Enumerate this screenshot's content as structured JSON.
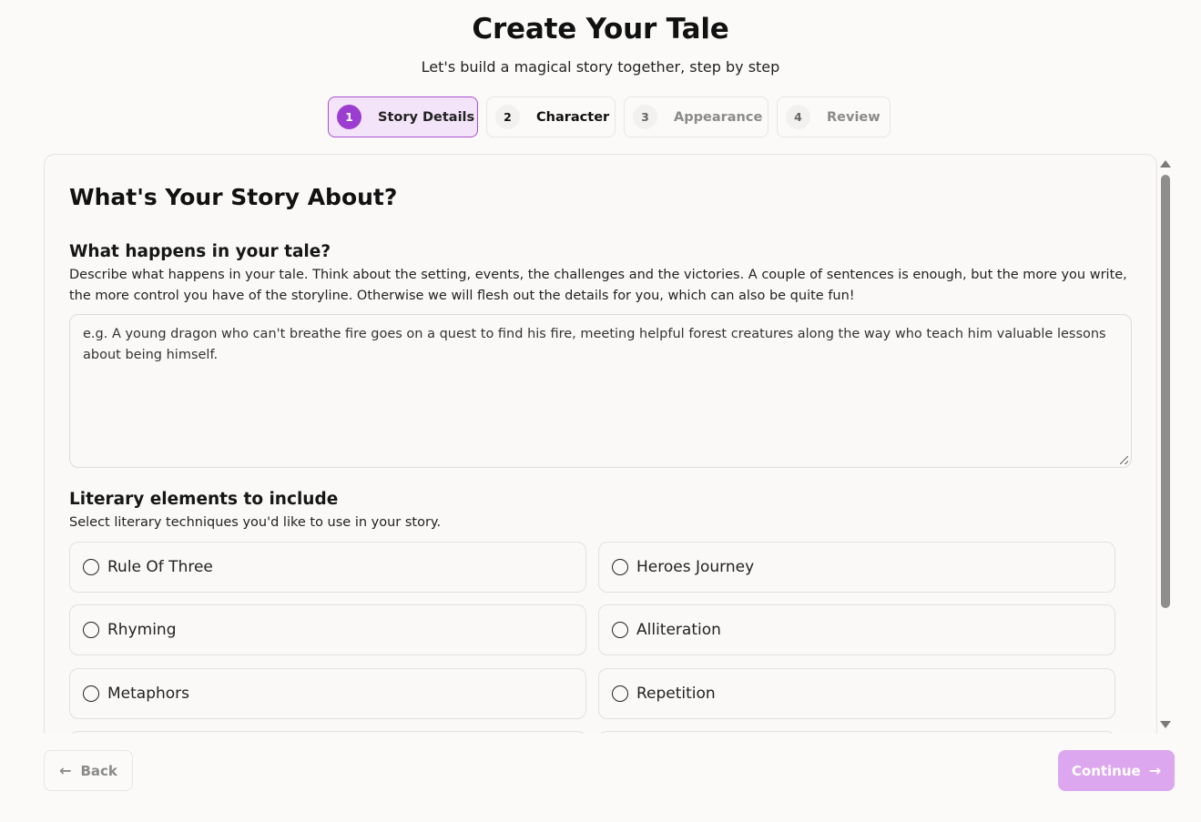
{
  "header": {
    "title": "Create Your Tale",
    "subtitle": "Let's build a magical story together, step by step"
  },
  "steps": [
    {
      "number": "1",
      "label": "Story Details",
      "state": "active"
    },
    {
      "number": "2",
      "label": "Character",
      "state": "upcoming"
    },
    {
      "number": "3",
      "label": "Appearance",
      "state": "upcoming"
    },
    {
      "number": "4",
      "label": "Review",
      "state": "upcoming"
    }
  ],
  "card": {
    "heading": "What's Your Story About?",
    "story": {
      "title": "What happens in your tale?",
      "description": "Describe what happens in your tale. Think about the setting, events, the challenges and the victories. A couple of sentences is enough, but the more you write, the more control you have of the storyline. Otherwise we will flesh out the details for you, which can also be quite fun!",
      "placeholder": "e.g. A young dragon who can't breathe fire goes on a quest to find his fire, meeting helpful forest creatures along the way who teach him valuable lessons about being himself.",
      "value": ""
    },
    "literary": {
      "title": "Literary elements to include",
      "description": "Select literary techniques you'd like to use in your story.",
      "options": [
        {
          "label": "Rule Of Three",
          "selected": false
        },
        {
          "label": "Heroes Journey",
          "selected": false
        },
        {
          "label": "Rhyming",
          "selected": false
        },
        {
          "label": "Alliteration",
          "selected": false
        },
        {
          "label": "Metaphors",
          "selected": false
        },
        {
          "label": "Repetition",
          "selected": false
        }
      ]
    }
  },
  "footer": {
    "back_label": "Back",
    "continue_label": "Continue"
  },
  "colors": {
    "accent": "#9b3dd0",
    "accent_light": "#f4e4f9",
    "continue_disabled": "#dda7ef"
  },
  "icons": {
    "back": "arrow-left-icon",
    "continue": "arrow-right-icon"
  }
}
